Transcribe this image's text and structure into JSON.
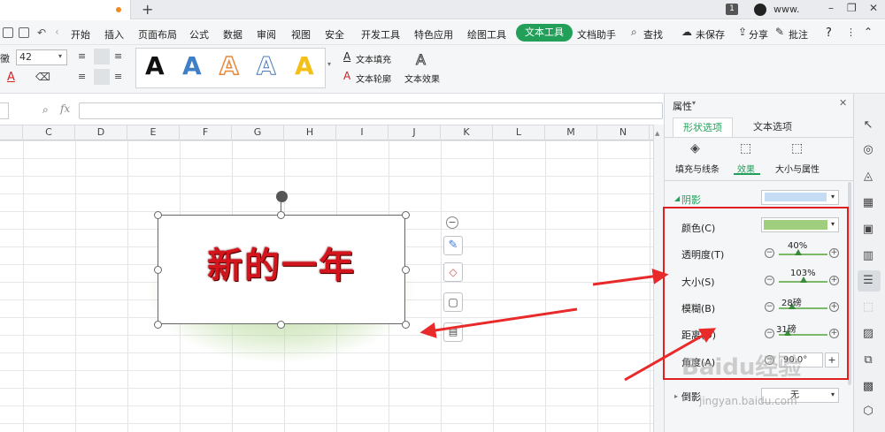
{
  "window": {
    "badge": "1",
    "username": "www.",
    "min": "–",
    "restore": "❐",
    "close": "✕",
    "new_tab": "+"
  },
  "menu": {
    "items": [
      "开始",
      "插入",
      "页面布局",
      "公式",
      "数据",
      "审阅",
      "视图",
      "安全",
      "开发工具",
      "特色应用",
      "绘图工具",
      "文本工具",
      "文档助手"
    ],
    "active": "文本工具",
    "search": "查找",
    "unsaved": "未保存",
    "share": "分享",
    "comment": "批注",
    "help": "?"
  },
  "ribbon": {
    "font_size": "42",
    "font_prefix": "黴",
    "text_fill": "文本填充",
    "text_outline": "文本轮廓",
    "text_effect": "文本效果",
    "style_letter": "A"
  },
  "formula": {
    "fx": "fx"
  },
  "grid": {
    "columns": [
      "C",
      "D",
      "E",
      "F",
      "G",
      "H",
      "I",
      "J",
      "K",
      "L",
      "M",
      "N"
    ]
  },
  "textbox": {
    "text": "新的一年"
  },
  "panel": {
    "title": "属性",
    "tab_shape": "形状选项",
    "tab_text": "文本选项",
    "sub_fill": "填充与线条",
    "sub_effect": "效果",
    "sub_size": "大小与属性",
    "shadow_section": "阴影",
    "color_label": "颜色(C)",
    "transparency_label": "透明度(T)",
    "transparency_value": "40%",
    "size_label": "大小(S)",
    "size_value": "103%",
    "blur_label": "模糊(B)",
    "blur_value": "28磅",
    "distance_label": "距离(D)",
    "distance_value": "31磅",
    "angle_label": "角度(A)",
    "angle_value": "90.0°",
    "reflection_section": "倒影",
    "reflection_value": "无"
  },
  "colors": {
    "accent": "#22a05a",
    "shadow_color": "#9fce7f",
    "shadow_preset": "#c6dcf5",
    "text_red": "#d4141c",
    "highlight_red": "#e02020"
  },
  "watermark": {
    "logo": "Baidu经验",
    "url": "jingyan.baidu.com"
  },
  "transparency_level": 0.4,
  "size_level": 0.5,
  "blur_level": 0.27,
  "distance_level": 0.18
}
